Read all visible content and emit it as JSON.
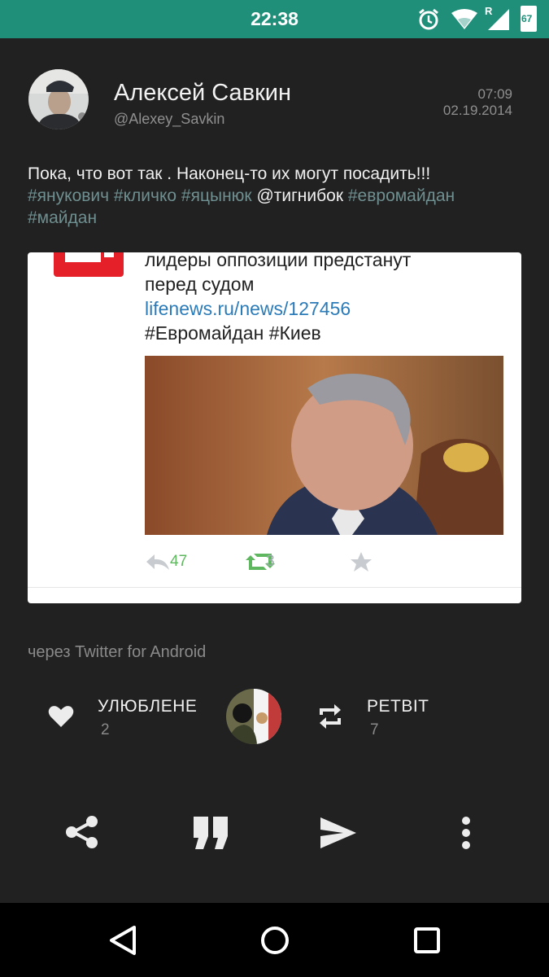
{
  "status_bar": {
    "time": "22:38",
    "icons": [
      "alarm-icon",
      "wifi-icon",
      "signal-icon",
      "battery-icon"
    ],
    "roaming_indicator": "R",
    "battery_level": "67"
  },
  "tweet": {
    "author_name": "Алексей Савкин",
    "author_handle": "@Alexey_Savkin",
    "time": "07:09",
    "date": "02.19.2014",
    "text_plain": "Пока, что вот так . Наконец-то их могут посадить!!!",
    "hashtags": [
      "#янукович",
      "#кличко",
      "#яцынюк"
    ],
    "mention": "@тигнибок",
    "hashtags2": [
      "#евромайдан",
      "#майдан"
    ]
  },
  "media_card": {
    "line1": "лидеры оппозиции предстанут",
    "line2": "перед судом",
    "link": "lifenews.ru/news/127456",
    "tags": "#Евромайдан #Киев",
    "retweets": "47",
    "favorites": "3"
  },
  "via": "через Twitter for Android",
  "stats": {
    "likes_label": "УЛЮБЛЕНЕ",
    "likes_count": "2",
    "retweets_label": "РЕТВІТ",
    "retweets_count": "7"
  },
  "action_bar": [
    "share-icon",
    "quote-icon",
    "send-icon",
    "more-vert-icon"
  ],
  "nav_bar": [
    "back-icon",
    "home-icon",
    "recents-icon"
  ],
  "colors": {
    "accent": "#1f8f7a",
    "background": "#212121",
    "hashtag": "#6f8f90"
  }
}
